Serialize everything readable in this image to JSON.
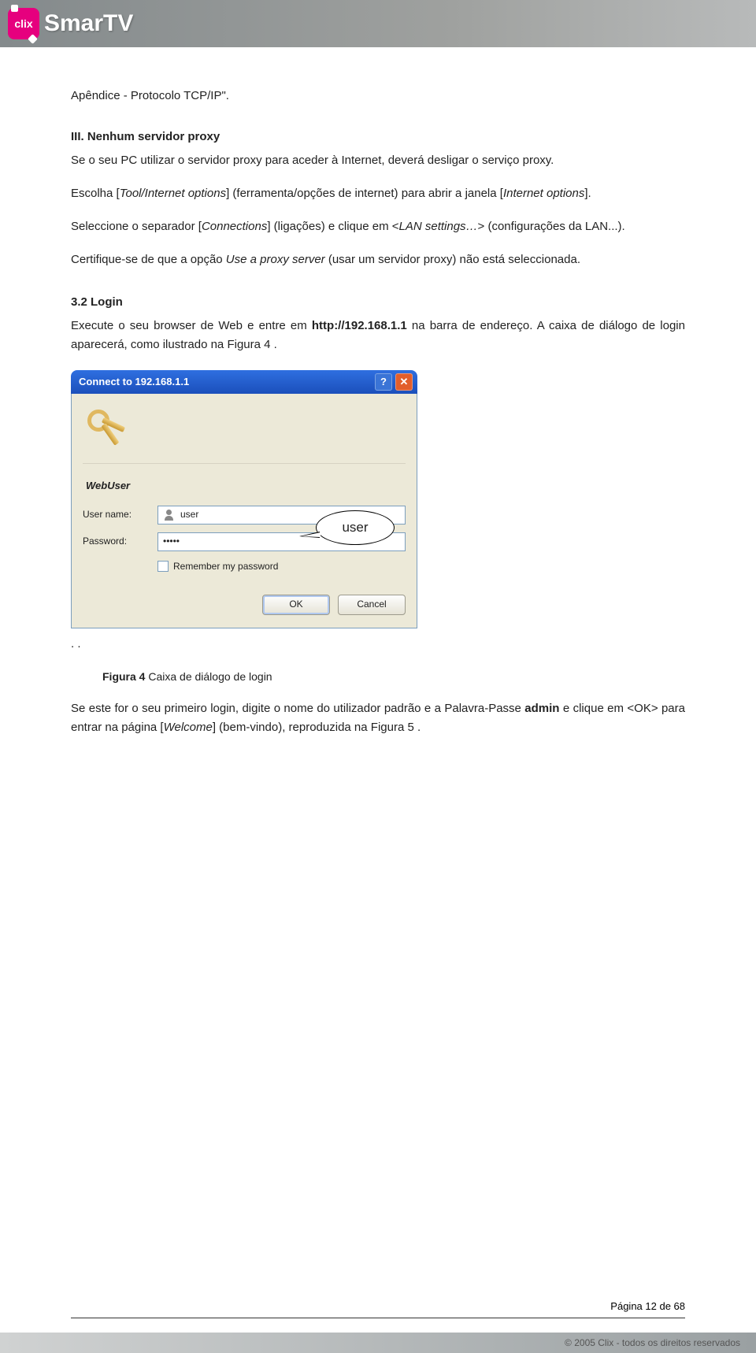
{
  "header": {
    "logo_badge": "clix",
    "logo_text": "SmarTV"
  },
  "body": {
    "p1": "Apêndice - Protocolo TCP/IP\".",
    "h_iii": "III. Nenhum servidor proxy",
    "p2": "Se o seu PC utilizar o servidor proxy para aceder à Internet, deverá desligar o serviço proxy.",
    "p3_a": "Escolha [",
    "p3_i1": "Tool/Internet options",
    "p3_b": "] (ferramenta/opções de internet) para abrir a janela [",
    "p3_i2": "Internet options",
    "p3_c": "].",
    "p4_a": "Seleccione o separador [",
    "p4_i1": "Connections",
    "p4_b": "] (ligações) e clique em <",
    "p4_i2": "LAN settings…",
    "p4_c": "> (configurações da LAN...).",
    "p5_a": "Certifique-se de que a opção ",
    "p5_i1": "Use a proxy server",
    "p5_b": " (usar um servidor proxy) não está seleccionada.",
    "h_32": "3.2 Login",
    "p6_a": "Execute o seu browser de Web e entre em ",
    "p6_b": "http://192.168.1.1",
    "p6_c": " na barra de endereço. A caixa de diálogo de login aparecerá, como ilustrado na Figura 4 .",
    "dots": ". .",
    "fig_label_b": "Figura 4",
    "fig_label_r": "  Caixa de diálogo de login",
    "p7_a": "Se este for o seu primeiro login, digite o nome do utilizador padrão e a Palavra-Passe ",
    "p7_b": "admin",
    "p7_c": " e clique em <OK> para entrar na página [",
    "p7_i1": "Welcome",
    "p7_d": "] (bem-vindo), reproduzida na Figura 5 ."
  },
  "dialog": {
    "title": "Connect to 192.168.1.1",
    "help_btn": "?",
    "close_btn": "✕",
    "site": "WebUser",
    "username_label": "User name:",
    "username_value": "user",
    "password_label": "Password:",
    "password_value": "•••••",
    "remember_label": "Remember my password",
    "ok": "OK",
    "cancel": "Cancel",
    "callout": "user"
  },
  "footer": {
    "page": "Página 12 de 68",
    "copyright": "© 2005 Clix - todos os direitos reservados"
  }
}
